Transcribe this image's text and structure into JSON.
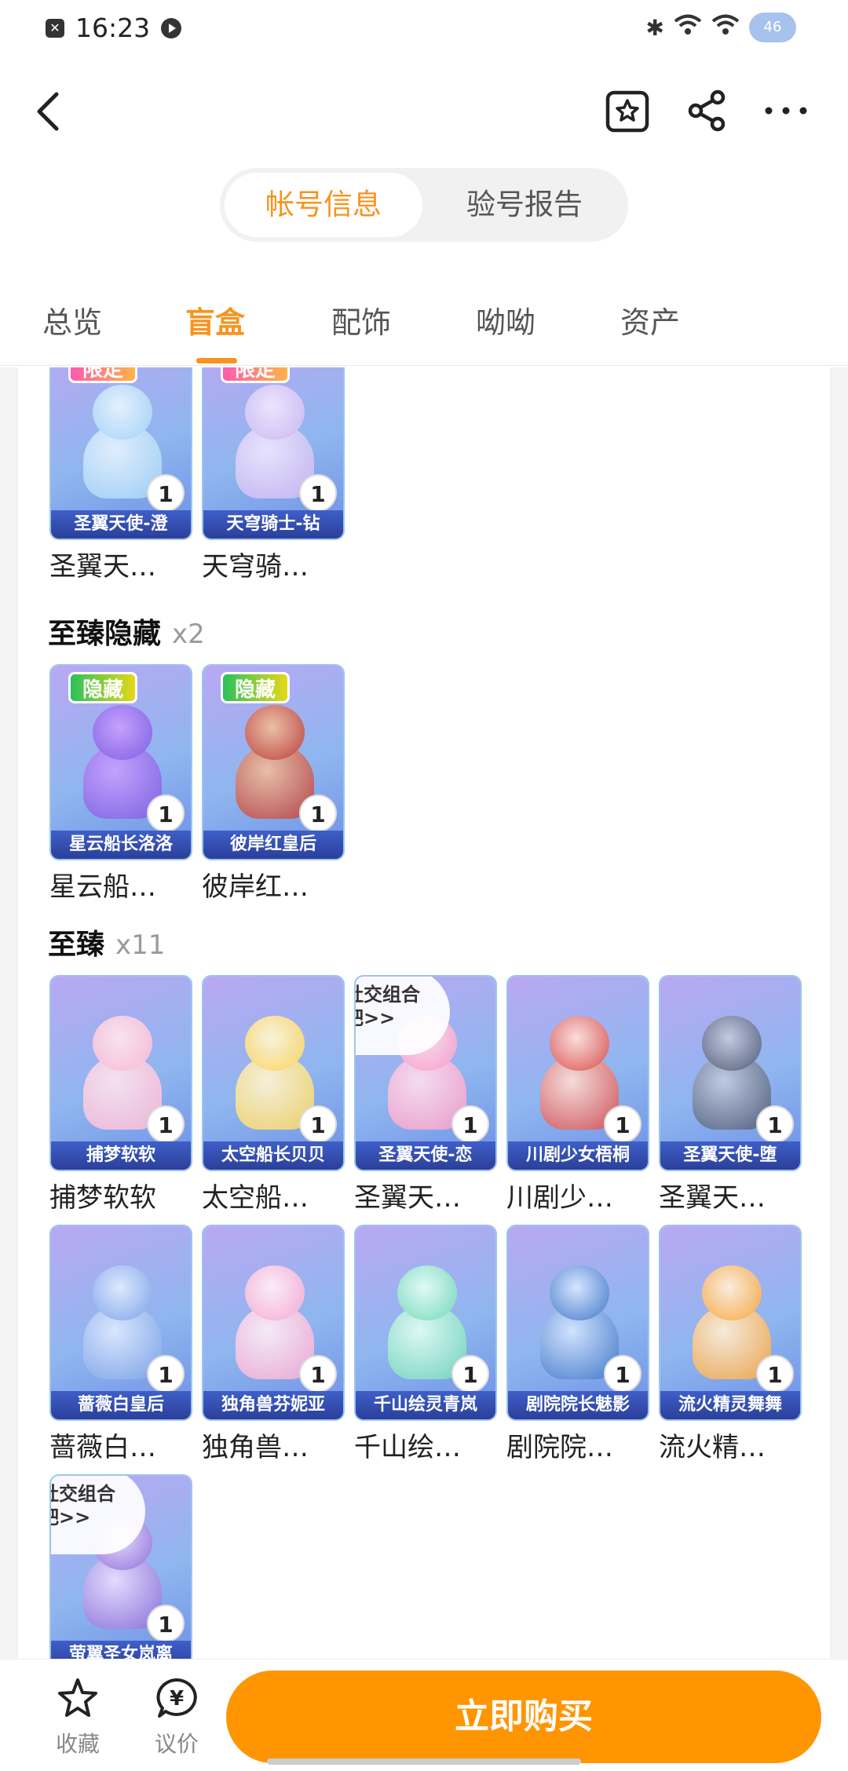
{
  "status_bar": {
    "time": "16:23",
    "battery": "46"
  },
  "segment": {
    "active": "帐号信息",
    "inactive": "验号报告"
  },
  "tabs": [
    {
      "label": "总览"
    },
    {
      "label": "盲盒"
    },
    {
      "label": "配饰"
    },
    {
      "label": "呦呦"
    },
    {
      "label": "资产"
    }
  ],
  "limited_cards": [
    {
      "tag": "限定",
      "strip": "圣翼天使-澄",
      "name": "圣翼天…",
      "count": "1",
      "colors": [
        "#9fd0f5",
        "#e8f4ff"
      ]
    },
    {
      "tag": "限定",
      "strip": "天穹骑士-钻",
      "name": "天穹骑…",
      "count": "1",
      "colors": [
        "#c8b4f0",
        "#f0e8ff"
      ]
    }
  ],
  "hidden_section": {
    "title": "至臻隐藏",
    "count": "x2"
  },
  "hidden_cards": [
    {
      "tag": "隐藏",
      "strip": "星云船长洛洛",
      "name": "星云船…",
      "count": "1",
      "colors": [
        "#7a5be0",
        "#c9a0ff"
      ]
    },
    {
      "tag": "隐藏",
      "strip": "彼岸红皇后",
      "name": "彼岸红…",
      "count": "1",
      "colors": [
        "#b83a3a",
        "#f0c0a0"
      ]
    }
  ],
  "zhizhen_section": {
    "title": "至臻",
    "count": "x11"
  },
  "zhizhen_cards": [
    {
      "strip": "捕梦软软",
      "name": "捕梦软软",
      "count": "1",
      "colors": [
        "#f7b6d4",
        "#fde6f0"
      ],
      "overlay": ""
    },
    {
      "strip": "太空船长贝贝",
      "name": "太空船…",
      "count": "1",
      "colors": [
        "#f6d35a",
        "#fff6d8"
      ],
      "overlay": ""
    },
    {
      "strip": "圣翼天使-恋",
      "name": "圣翼天…",
      "count": "1",
      "colors": [
        "#f49ac7",
        "#ffe0f0"
      ],
      "overlay": "社交组合\n吧>>"
    },
    {
      "strip": "川剧少女梧桐",
      "name": "川剧少…",
      "count": "1",
      "colors": [
        "#d64848",
        "#ffe0d8"
      ],
      "overlay": ""
    },
    {
      "strip": "圣翼天使-堕",
      "name": "圣翼天…",
      "count": "1",
      "colors": [
        "#4a5570",
        "#c4cce0"
      ],
      "overlay": ""
    },
    {
      "strip": "蔷薇白皇后",
      "name": "蔷薇白…",
      "count": "1",
      "colors": [
        "#7aa0e6",
        "#e0ecff"
      ],
      "overlay": ""
    },
    {
      "strip": "独角兽芬妮亚",
      "name": "独角兽…",
      "count": "1",
      "colors": [
        "#f4a6d0",
        "#fff0f8"
      ],
      "overlay": ""
    },
    {
      "strip": "千山绘灵青岚",
      "name": "千山绘…",
      "count": "1",
      "colors": [
        "#6fd6b8",
        "#e4fff4"
      ],
      "overlay": ""
    },
    {
      "strip": "剧院院长魅影",
      "name": "剧院院…",
      "count": "1",
      "colors": [
        "#3a72c6",
        "#d8e8ff"
      ],
      "overlay": ""
    },
    {
      "strip": "流火精灵舞舞",
      "name": "流火精…",
      "count": "1",
      "colors": [
        "#f6a23a",
        "#fff0d8"
      ],
      "overlay": ""
    },
    {
      "strip": "萤翼圣女岚离",
      "name": "",
      "count": "1",
      "colors": [
        "#8a6ad6",
        "#ecdfff"
      ],
      "overlay": "社交组合\n吧>>"
    }
  ],
  "bottom_bar": {
    "favorite": "收藏",
    "bargain": "议价",
    "bargain_glyph": "¥",
    "buy": "立即购买"
  },
  "colors": {
    "accent": "#f7931e",
    "buy": "#ff9500"
  }
}
